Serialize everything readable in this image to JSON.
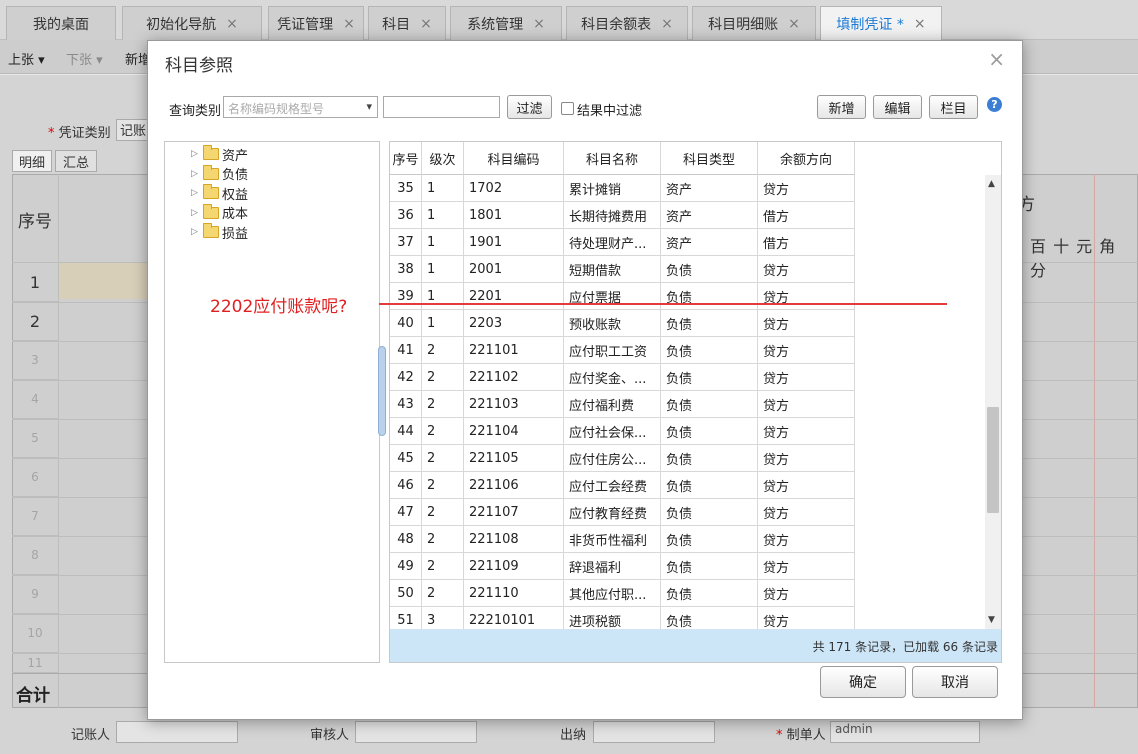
{
  "tabs": [
    {
      "label": "我的桌面",
      "closable": false,
      "active": false
    },
    {
      "label": "初始化导航",
      "closable": true,
      "active": false
    },
    {
      "label": "凭证管理",
      "closable": true,
      "active": false
    },
    {
      "label": "科目",
      "closable": true,
      "active": false
    },
    {
      "label": "系统管理",
      "closable": true,
      "active": false
    },
    {
      "label": "科目余额表",
      "closable": true,
      "active": false
    },
    {
      "label": "科目明细账",
      "closable": true,
      "active": false
    },
    {
      "label": "填制凭证 *",
      "closable": true,
      "active": true
    }
  ],
  "toolbar": {
    "prev": "上张 ▾",
    "next": "下张 ▾",
    "new": "新增"
  },
  "form": {
    "voucher_type_label": "凭证类别",
    "voucher_type_value": "记账",
    "subtab_detail": "明细",
    "subtab_summary": "汇总",
    "col_seq": "序号",
    "col_direction_partial": "方",
    "amount_units": "百 十 元 角 分",
    "row_numbers": [
      "1",
      "2",
      "3",
      "4",
      "5",
      "6",
      "7",
      "8",
      "9",
      "10",
      "11"
    ],
    "total_label": "合计",
    "bookkeeper_label": "记账人",
    "reviewer_label": "审核人",
    "cashier_label": "出纳",
    "maker_label": "制单人",
    "maker_value": "admin"
  },
  "dialog": {
    "title": "科目参照",
    "close": "×",
    "query_label": "查询类别",
    "query_placeholder": "名称编码规格型号",
    "query_arrow": "▾",
    "filter_button": "过滤",
    "filter_in_results": "结果中过滤",
    "add_button": "新增",
    "edit_button": "编辑",
    "columns_button": "栏目",
    "help": "?",
    "tree": [
      "资产",
      "负债",
      "权益",
      "成本",
      "损益"
    ],
    "table_headers": [
      "序号",
      "级次",
      "科目编码",
      "科目名称",
      "科目类型",
      "余额方向"
    ],
    "rows": [
      [
        "35",
        "1",
        "1702",
        "累计摊销",
        "资产",
        "贷方"
      ],
      [
        "36",
        "1",
        "1801",
        "长期待摊费用",
        "资产",
        "借方"
      ],
      [
        "37",
        "1",
        "1901",
        "待处理财产...",
        "资产",
        "借方"
      ],
      [
        "38",
        "1",
        "2001",
        "短期借款",
        "负债",
        "贷方"
      ],
      [
        "39",
        "1",
        "2201",
        "应付票据",
        "负债",
        "贷方"
      ],
      [
        "40",
        "1",
        "2203",
        "预收账款",
        "负债",
        "贷方"
      ],
      [
        "41",
        "2",
        "221101",
        "应付职工工资",
        "负债",
        "贷方"
      ],
      [
        "42",
        "2",
        "221102",
        "应付奖金、...",
        "负债",
        "贷方"
      ],
      [
        "43",
        "2",
        "221103",
        "应付福利费",
        "负债",
        "贷方"
      ],
      [
        "44",
        "2",
        "221104",
        "应付社会保...",
        "负债",
        "贷方"
      ],
      [
        "45",
        "2",
        "221105",
        "应付住房公...",
        "负债",
        "贷方"
      ],
      [
        "46",
        "2",
        "221106",
        "应付工会经费",
        "负债",
        "贷方"
      ],
      [
        "47",
        "2",
        "221107",
        "应付教育经费",
        "负债",
        "贷方"
      ],
      [
        "48",
        "2",
        "221108",
        "非货币性福利",
        "负债",
        "贷方"
      ],
      [
        "49",
        "2",
        "221109",
        "辞退福利",
        "负债",
        "贷方"
      ],
      [
        "50",
        "2",
        "221110",
        "其他应付职...",
        "负债",
        "贷方"
      ],
      [
        "51",
        "3",
        "22210101",
        "进项税额",
        "负债",
        "贷方"
      ]
    ],
    "footer": "共 171 条记录，已加载 66 条记录",
    "ok_button": "确定",
    "cancel_button": "取消"
  },
  "annotation": "2202应付账款呢?",
  "colors": {
    "accent": "#1a7ad6",
    "annotation": "#e02020",
    "footer_bg": "#cde6f7"
  }
}
